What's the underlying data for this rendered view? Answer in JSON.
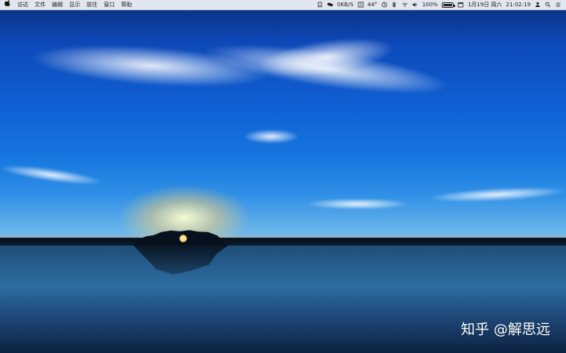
{
  "menubar": {
    "apple_icon": "apple-icon",
    "left_items": [
      "访达",
      "文件",
      "编辑",
      "显示",
      "前往",
      "窗口",
      "帮助"
    ],
    "status_icons": [
      "bookmark-icon",
      "wechat-icon",
      "upload-download-icon",
      "info-icon",
      "clock-icon",
      "bluetooth-icon",
      "wifi-icon",
      "volume-icon"
    ],
    "temperature": "44°",
    "network_value": "0KB/S",
    "battery_percent": "100%",
    "battery_level": 1.0,
    "calendar_icon": "calendar-icon",
    "date_text": "1月19日 周六",
    "time_text": "21:02:19",
    "user_icon": "user-icon",
    "search_icon": "search-icon",
    "control_center_icon": "control-center-icon"
  },
  "watermark": {
    "text": "知乎 @解思远"
  },
  "colors": {
    "menubar_bg": "#f3f4f6",
    "menubar_text": "#1c1c1c",
    "sky_top": "#0a2f7a",
    "sky_mid": "#0f60d3",
    "sunset": "#f9c061",
    "water": "#2d6da1"
  }
}
